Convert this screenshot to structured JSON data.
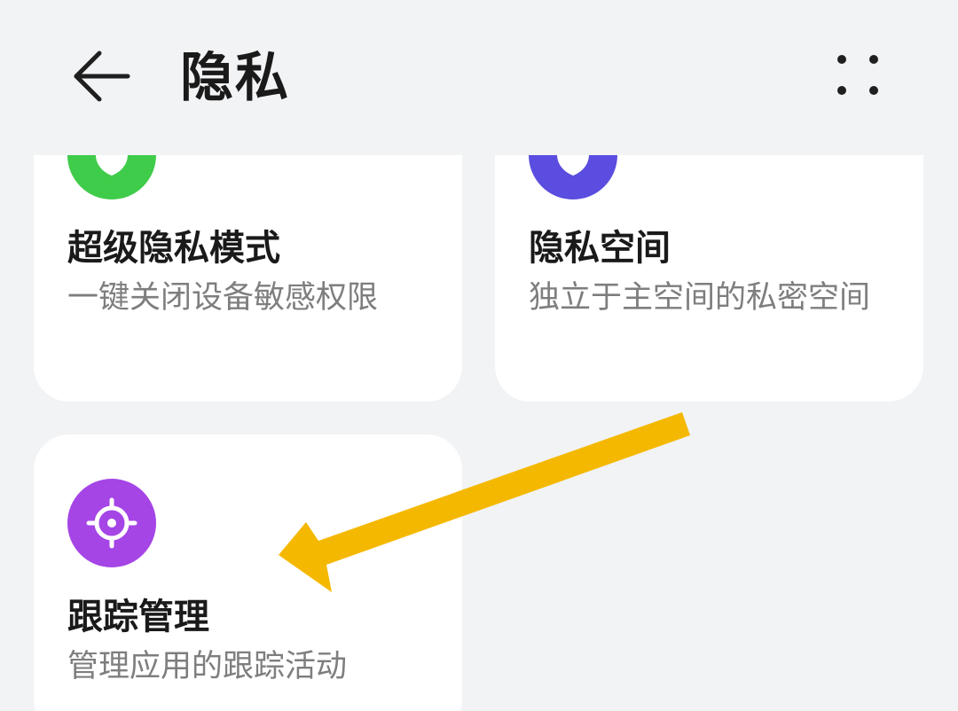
{
  "header": {
    "title": "隐私"
  },
  "cards": [
    {
      "title": "超级隐私模式",
      "description": "一键关闭设备敏感权限",
      "icon": "shield-icon",
      "icon_color": "#3fcc4a"
    },
    {
      "title": "隐私空间",
      "description": "独立于主空间的私密空间",
      "icon": "shield-icon",
      "icon_color": "#5a4ddf"
    },
    {
      "title": "跟踪管理",
      "description": "管理应用的跟踪活动",
      "icon": "crosshair-icon",
      "icon_color": "#a545e6"
    }
  ],
  "annotation": {
    "arrow_color": "#f5b800",
    "points_to": "跟踪管理"
  },
  "colors": {
    "background": "#f1f3f5",
    "card_background": "#ffffff"
  }
}
